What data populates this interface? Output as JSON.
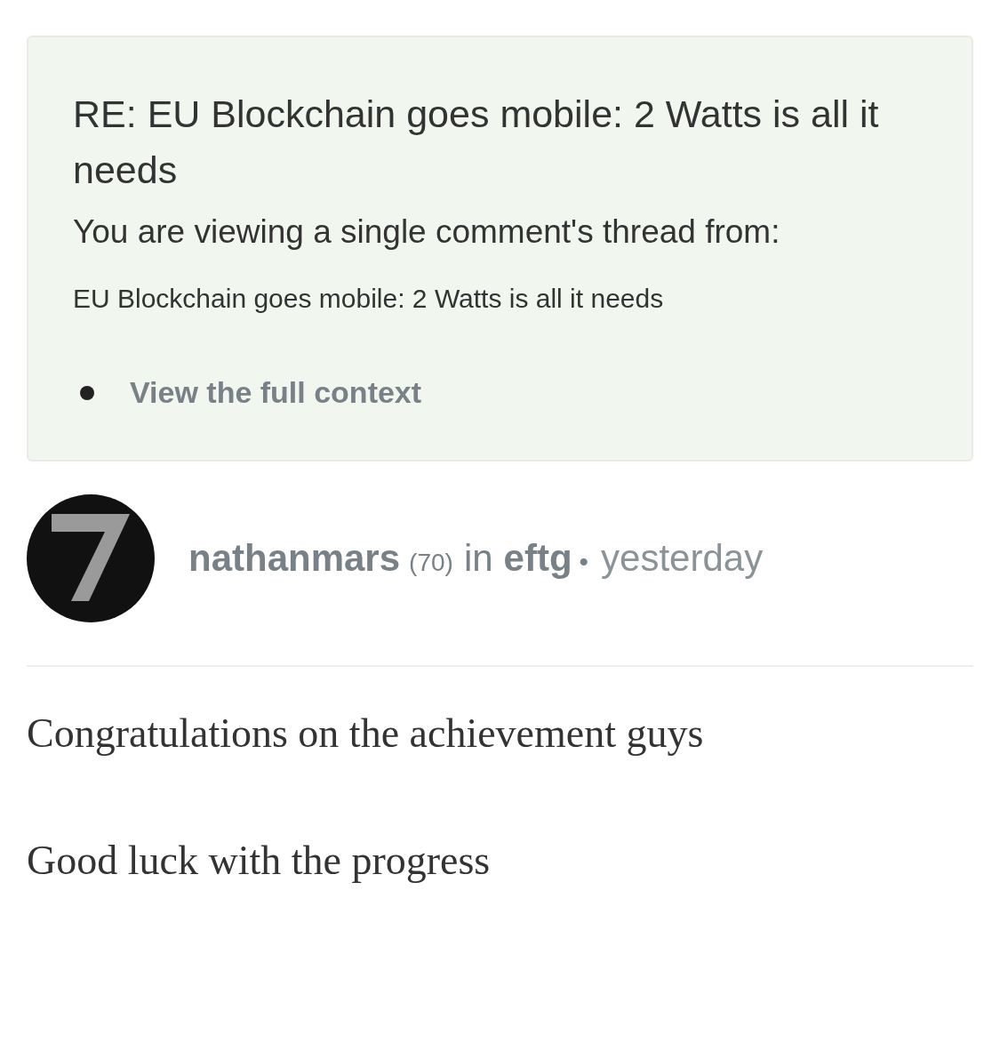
{
  "thread_header": {
    "title": "RE: EU Blockchain goes mobile: 2 Watts is all it needs",
    "notice": "You are viewing a single comment's thread from:",
    "parent_title": "EU Blockchain goes mobile: 2 Watts is all it needs",
    "links": [
      "View the full context"
    ]
  },
  "comment": {
    "author": "nathanmars",
    "reputation": "(70)",
    "preposition": "in",
    "community": "eftg",
    "separator": "•",
    "time": "yesterday",
    "paragraphs": [
      "Congratulations on the achievement guys",
      "Good luck with the progress"
    ]
  }
}
